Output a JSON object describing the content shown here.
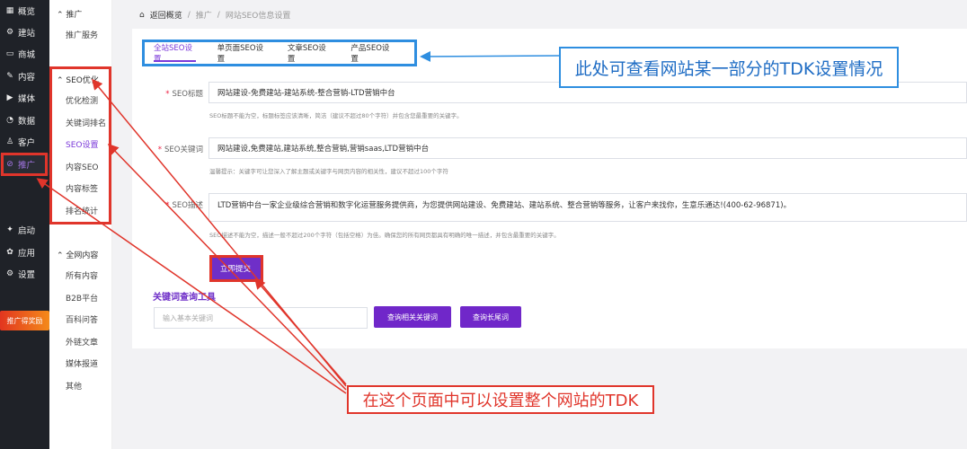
{
  "nav_primary": [
    {
      "label": "概览",
      "icon": "grid-icon"
    },
    {
      "label": "建站",
      "icon": "gear-icon"
    },
    {
      "label": "商城",
      "icon": "shop-icon"
    },
    {
      "label": "内容",
      "icon": "edit-icon"
    },
    {
      "label": "媒体",
      "icon": "media-icon"
    },
    {
      "label": "数据",
      "icon": "chart-icon"
    },
    {
      "label": "客户",
      "icon": "user-icon"
    },
    {
      "label": "推广",
      "icon": "link-icon"
    },
    {
      "label": "启动",
      "icon": "rocket-icon"
    },
    {
      "label": "应用",
      "icon": "apps-icon"
    },
    {
      "label": "设置",
      "icon": "settings-icon"
    }
  ],
  "promo_badge": "推广得奖励",
  "nav_secondary": {
    "group1_title": "推广",
    "group1_items": [
      "推广服务"
    ],
    "group2_title": "SEO优化",
    "group2_items": [
      "优化检测",
      "关键词排名",
      "SEO设置",
      "内容SEO",
      "内容标签",
      "排名统计"
    ],
    "group3_title": "全网内容",
    "group3_items": [
      "所有内容",
      "B2B平台",
      "百科问答",
      "外链文章",
      "媒体报道",
      "其他"
    ]
  },
  "breadcrumb": {
    "home": "返回概览",
    "sep": "/",
    "level1": "推广",
    "level2": "网站SEO信息设置"
  },
  "tabs": [
    "全站SEO设置",
    "单页面SEO设置",
    "文章SEO设置",
    "产品SEO设置"
  ],
  "form": {
    "title_label": "SEO标题",
    "title_value": "网站建设-免费建站-建站系统-整合营销-LTD营销中台",
    "title_hint": "SEO标题不能为空，标题标签应该清晰，简洁（建议不超过80个字符）并包含您最重要的关键字。",
    "keywords_label": "SEO关键词",
    "keywords_value": "网站建设,免费建站,建站系统,整合营销,营销saas,LTD营销中台",
    "keywords_hint": "温馨提示：关键字可让您深入了解主题或关键字与网页内容的相关性，建议不超过100个字符",
    "desc_label": "SEO描述",
    "desc_value": "LTD营销中台一家企业级综合营销和数字化运营服务提供商，为您提供网站建设、免费建站、建站系统、整合营销等服务，让客户来找你，生意乐通达!(400-62-96871)。",
    "desc_hint": "SEO描述不能为空，描述一般不超过200个字符（包括空格）为佳。确保您的所有网页都具有明确的唯一描述，并包含最重要的关键字。",
    "submit_label": "立即提交"
  },
  "tool": {
    "title": "关键词查询工具",
    "placeholder": "输入基本关键词",
    "btn_related": "查询相关关键词",
    "btn_longtail": "查询长尾词"
  },
  "callouts": {
    "blue": "此处可查看网站某一部分的TDK设置情况",
    "red": "在这个页面中可以设置整个网站的TDK"
  },
  "colors": {
    "accent": "#6f2fc8",
    "annotation_red": "#e0352b",
    "annotation_blue": "#2e8ee0"
  }
}
